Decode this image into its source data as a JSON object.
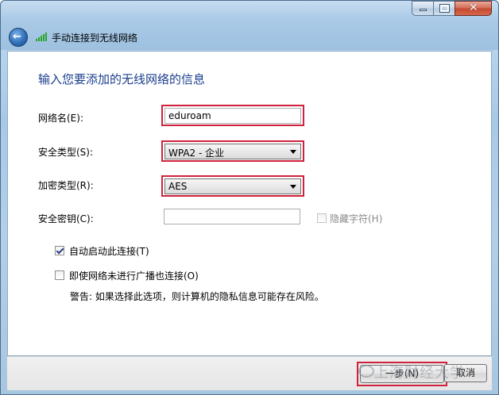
{
  "window": {
    "title": "手动连接到无线网络",
    "controls": {
      "min": "",
      "max": "",
      "close": "✕"
    }
  },
  "form": {
    "heading": "输入您要添加的无线网络的信息",
    "network_name_label": "网络名(E):",
    "network_name_value": "eduroam",
    "security_type_label": "安全类型(S):",
    "security_type_value": "WPA2 - 企业",
    "encryption_type_label": "加密类型(R):",
    "encryption_type_value": "AES",
    "security_key_label": "安全密钥(C):",
    "security_key_value": "",
    "hide_chars_label": "隐藏字符(H)",
    "auto_start_label": "自动启动此连接(T)",
    "auto_start_checked": true,
    "connect_hidden_label": "即使网络未进行广播也连接(O)",
    "connect_hidden_checked": false,
    "warning_text": "警告: 如果选择此选项，则计算机的隐私信息可能存在风险。"
  },
  "footer": {
    "next_label": "一步(N)",
    "cancel_label": "取消"
  },
  "watermark": "上海财经大学",
  "colors": {
    "highlight": "#d0213c",
    "heading": "#1a3e8e"
  }
}
